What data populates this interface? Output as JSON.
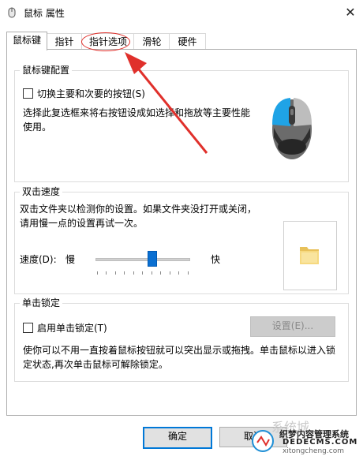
{
  "window": {
    "title": "鼠标 属性",
    "close_glyph": "✕"
  },
  "tabs": [
    {
      "label": "鼠标键",
      "active": true
    },
    {
      "label": "指针",
      "active": false
    },
    {
      "label": "指针选项",
      "active": false
    },
    {
      "label": "滑轮",
      "active": false
    },
    {
      "label": "硬件",
      "active": false
    }
  ],
  "button_config": {
    "legend": "鼠标键配置",
    "switch_label": "切换主要和次要的按钮(S)",
    "switch_checked": false,
    "description": "选择此复选框来将右按钮设成如选择和拖放等主要性能使用。"
  },
  "double_click": {
    "legend": "双击速度",
    "description": "双击文件夹以检测你的设置。如果文件夹没打开或关闭，请用慢一点的设置再试一次。",
    "speed_label": "速度(D):",
    "slow_label": "慢",
    "fast_label": "快",
    "speed_value": 0.6
  },
  "click_lock": {
    "legend": "单击锁定",
    "enable_label": "启用单击锁定(T)",
    "enable_checked": false,
    "settings_button": "设置(E)...",
    "description": "使你可以不用一直按着鼠标按钮就可以突出显示或拖拽。单击鼠标以进入锁定状态,再次单击鼠标可解除锁定。"
  },
  "footer": {
    "ok_button": "确定",
    "cancel_button": "取消"
  },
  "watermark": {
    "brand": "系统城",
    "line1": "织梦内容管理系统",
    "line2": "DEDECMS.COM",
    "line3": "xitongcheng.com"
  },
  "colors": {
    "accent": "#0078d7",
    "annotation": "#e0302b"
  }
}
